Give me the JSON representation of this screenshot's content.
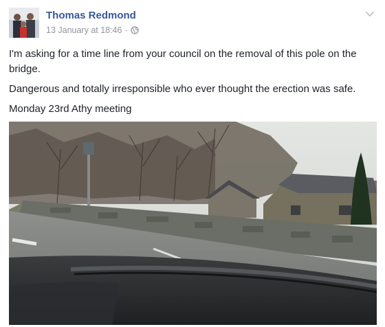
{
  "post": {
    "author_name": "Thomas Redmond",
    "timestamp": "13 January at 18:46",
    "separator": "·",
    "privacy_icon": "globe-icon",
    "menu_icon": "chevron-down-icon",
    "paragraphs": [
      "I'm asking for a time line from your council on the removal of this pole on the bridge.",
      "Dangerous and totally irresponsible who ever thought the erection was safe.",
      "Monday 23rd Athy meeting"
    ]
  },
  "colors": {
    "author_link": "#365899",
    "meta_text": "#90949c",
    "body_text": "#1d2129"
  }
}
